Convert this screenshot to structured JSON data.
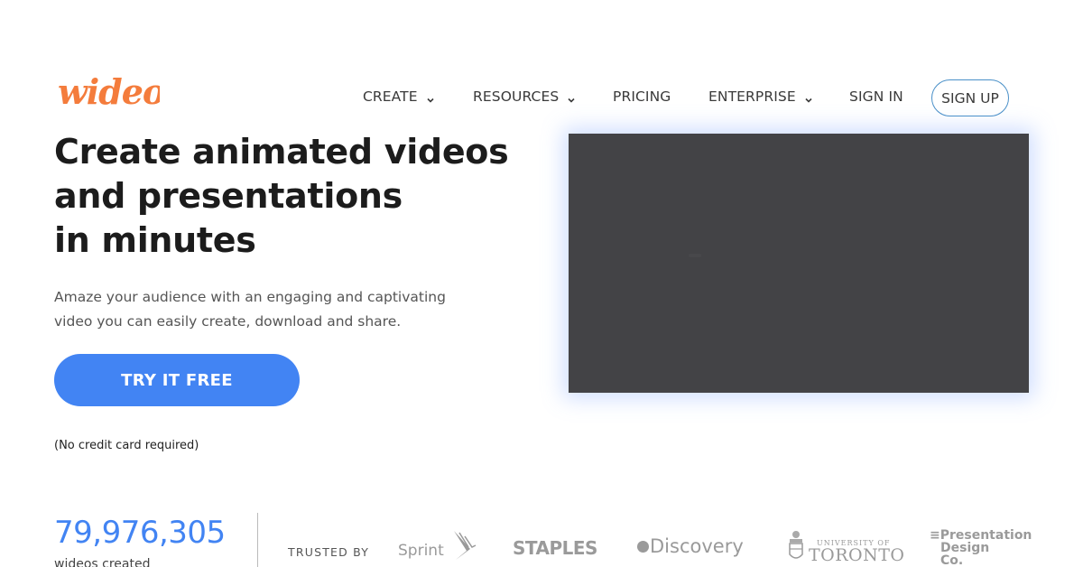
{
  "brand": {
    "name": "wideo",
    "color": "#f47c3c"
  },
  "nav": {
    "items": [
      {
        "label": "CREATE",
        "has_dropdown": true
      },
      {
        "label": "RESOURCES",
        "has_dropdown": true
      },
      {
        "label": "PRICING",
        "has_dropdown": false
      },
      {
        "label": "ENTERPRISE",
        "has_dropdown": true
      },
      {
        "label": "SIGN IN",
        "has_dropdown": false
      }
    ],
    "signup_label": "SIGN UP"
  },
  "hero": {
    "title_lines": [
      "Create animated videos",
      "and presentations",
      "in minutes"
    ],
    "subtitle": "Amaze your audience with an engaging and captivating video you can easily create, download and share.",
    "cta_label": "TRY IT FREE",
    "cta_color": "#4284f3",
    "note": "(No credit card required)"
  },
  "video": {
    "background": "#434346",
    "state": "loading"
  },
  "stats": {
    "count": "79,976,305",
    "count_label": "wideos created",
    "count_color": "#4284f3"
  },
  "trusted": {
    "label": "TRUSTED BY",
    "brands": [
      {
        "name": "Sprint"
      },
      {
        "name": "STAPLES"
      },
      {
        "name": "Discovery"
      },
      {
        "name": "University of Toronto",
        "line1": "UNIVERSITY OF",
        "line2": "TORONTO"
      },
      {
        "name": "Presentation Design Co.",
        "line1": "≡Presentation",
        "line2": "Design",
        "line3": "Co."
      }
    ]
  }
}
